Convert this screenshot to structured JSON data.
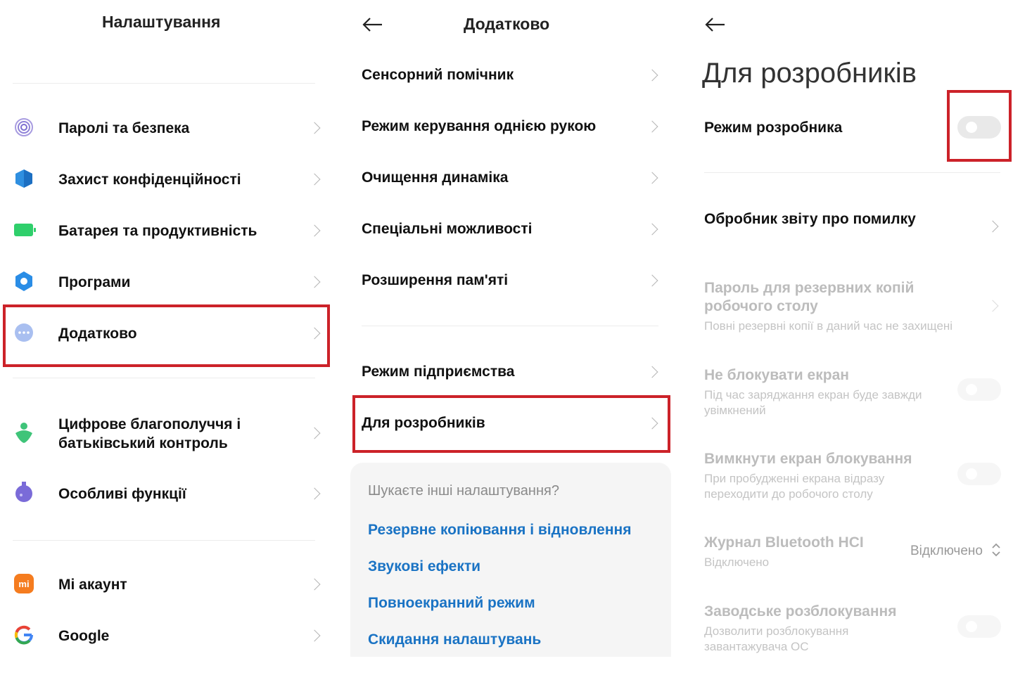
{
  "panel1": {
    "title": "Налаштування",
    "items": [
      {
        "label": "Паролі та безпека",
        "icon": "fingerprint-icon"
      },
      {
        "label": "Захист конфіденційності",
        "icon": "shield-icon"
      },
      {
        "label": "Батарея та продуктивність",
        "icon": "battery-icon"
      },
      {
        "label": "Програми",
        "icon": "gear-icon"
      },
      {
        "label": "Додатково",
        "icon": "more-dots-icon"
      },
      {
        "label": "Цифрове благополуччя і батьківський контроль",
        "icon": "wellbeing-icon"
      },
      {
        "label": "Особливі функції",
        "icon": "flask-icon"
      },
      {
        "label": "Mi акаунт",
        "icon": "mi-logo-icon"
      },
      {
        "label": "Google",
        "icon": "google-logo-icon"
      }
    ]
  },
  "panel2": {
    "title": "Додатково",
    "items": [
      {
        "label": "Сенсорний помічник"
      },
      {
        "label": "Режим керування однією рукою"
      },
      {
        "label": "Очищення динаміка"
      },
      {
        "label": "Спеціальні можливості"
      },
      {
        "label": "Розширення пам'яті"
      },
      {
        "label": "Режим підприємства"
      },
      {
        "label": "Для розробників"
      }
    ],
    "suggest": {
      "heading": "Шукаєте інші налаштування?",
      "links": [
        "Резервне копіювання і відновлення",
        "Звукові ефекти",
        "Повноекранний режим",
        "Скидання налаштувань"
      ]
    }
  },
  "panel3": {
    "title": "Для розробників",
    "dev_mode": {
      "label": "Режим розробника",
      "enabled": false
    },
    "bug_report": "Обробник звіту про помилку",
    "backup_password": {
      "title": "Пароль для резервних копій робочого столу",
      "subtitle": "Повні резервні копії в даний час не захищені"
    },
    "stay_awake": {
      "title": "Не блокувати екран",
      "subtitle": "Під час заряджання екран буде завжди увімкнений"
    },
    "disable_lock": {
      "title": "Вимкнути екран блокування",
      "subtitle": "При пробудженні екрана відразу переходити до робочого столу"
    },
    "bt_hci": {
      "title": "Журнал Bluetooth HCI",
      "subtitle": "Відключено",
      "value": "Відключено"
    },
    "oem_unlock": {
      "title": "Заводське розблокування",
      "subtitle": "Дозволити розблокування завантажувача ОС"
    }
  },
  "colors": {
    "highlight": "#cc2229",
    "link": "#1a73c4"
  }
}
